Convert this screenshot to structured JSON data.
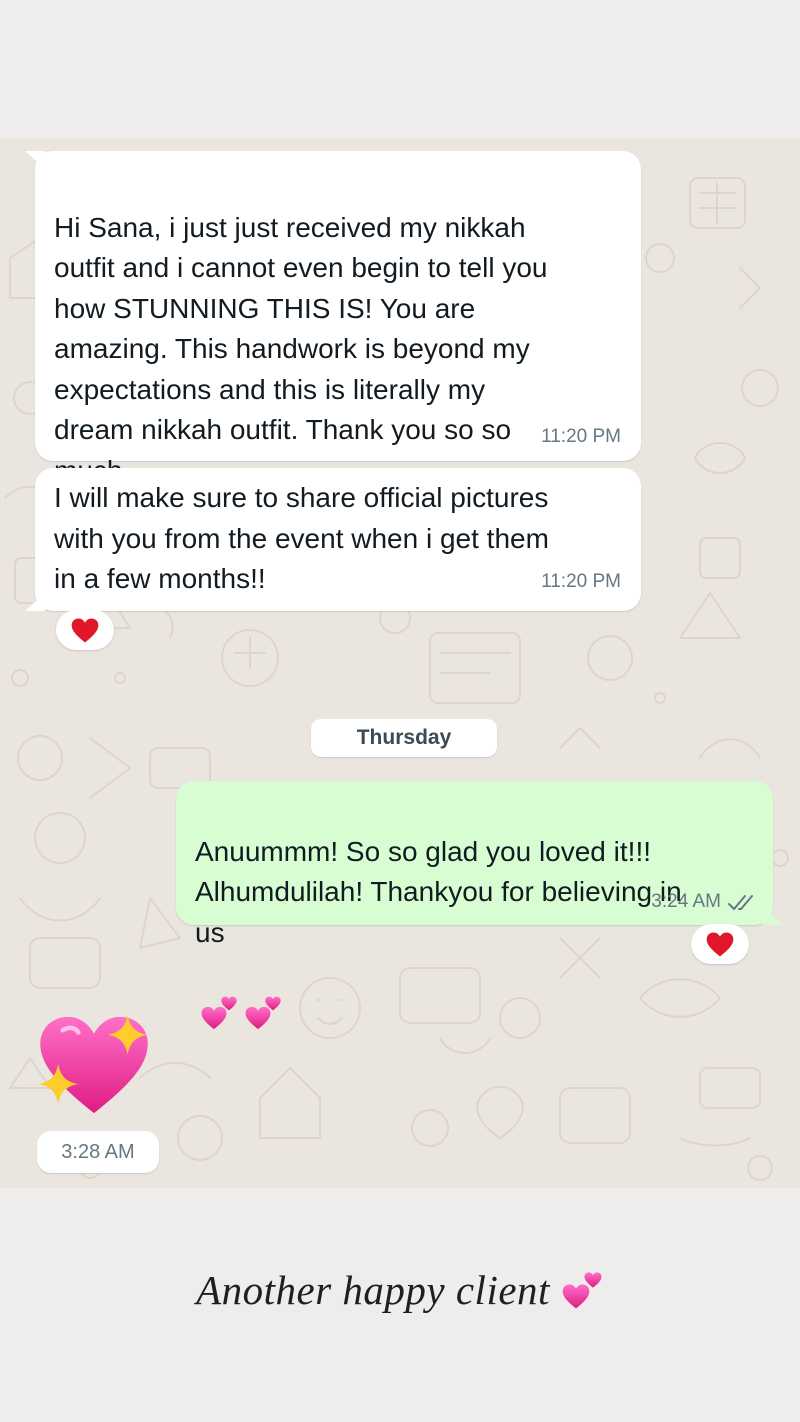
{
  "chat": {
    "messages": [
      {
        "direction": "incoming",
        "text": "Hi Sana, i just just received my nikkah\noutfit and i cannot even begin to tell you\nhow STUNNING THIS IS! You are\namazing. This handwork is beyond my\nexpectations and this is literally my\ndream nikkah outfit. Thank you so so\nmuch",
        "emoji": "sparkling-heart",
        "time": "11:20 PM"
      },
      {
        "direction": "incoming",
        "text": "I will make sure to share official pictures\nwith you from the event when i get them\nin a few months!!",
        "time": "11:20 PM",
        "reaction": "red-heart"
      },
      {
        "direction": "outgoing",
        "text": "Anuummm! So so glad you loved it!!!\nAlhumdulilah! Thankyou for believing in\nus",
        "emoji": "two-hearts two-hearts",
        "time": "3:24 AM",
        "status": "read",
        "reaction": "red-heart"
      },
      {
        "direction": "incoming",
        "type": "emoji-sticker",
        "emoji": "sparkling-heart",
        "time": "3:28 AM"
      }
    ],
    "day_separator": "Thursday"
  },
  "caption": {
    "text": "Another happy client",
    "emoji": "two-hearts"
  },
  "colors": {
    "incoming_bubble": "#ffffff",
    "outgoing_bubble": "#d9fdd3",
    "chat_background": "#eae6df",
    "page_background": "#efedeb",
    "timestamp": "#667781",
    "read_ticks": "#667781"
  }
}
